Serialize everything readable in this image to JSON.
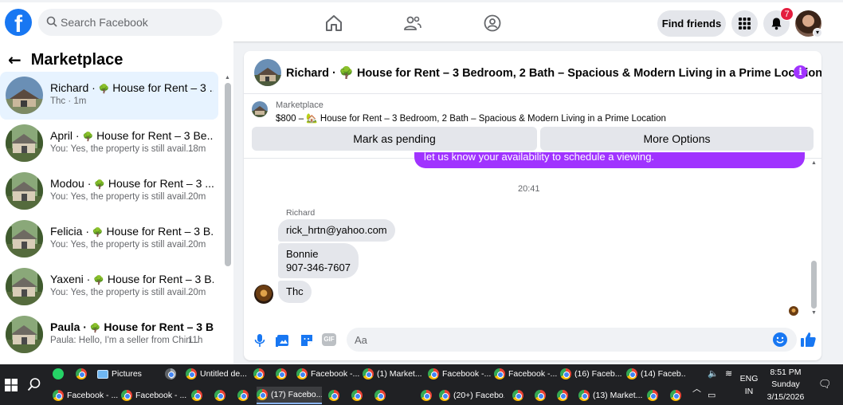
{
  "topbar": {
    "logo_letter": "f",
    "search_placeholder": "Search Facebook",
    "find_friends_label": "Find friends",
    "notification_count": "7"
  },
  "marketplace": {
    "title": "Marketplace",
    "conversations": [
      {
        "name": "Richard",
        "title": "House for Rent – 3 ...",
        "preview": "Thc · 1m",
        "time": "",
        "active": true,
        "bold": false
      },
      {
        "name": "April",
        "title": "House for Rent – 3 Be...",
        "preview": "You: Yes, the property is still avail...",
        "time": "18m",
        "active": false,
        "bold": false
      },
      {
        "name": "Modou",
        "title": "House for Rent – 3 ...",
        "preview": "You: Yes, the property is still avail...",
        "time": "20m",
        "active": false,
        "bold": false
      },
      {
        "name": "Felicia",
        "title": "House for Rent – 3 B...",
        "preview": "You: Yes, the property is still avail...",
        "time": "20m",
        "active": false,
        "bold": false
      },
      {
        "name": "Yaxeni",
        "title": "House for Rent – 3 B...",
        "preview": "You: Yes, the property is still avail...",
        "time": "20m",
        "active": false,
        "bold": false
      },
      {
        "name": "Paula",
        "title": "House for Rent – 3 Be...",
        "preview": "Paula: Hello, I'm a seller from Chin...",
        "time": "11h",
        "active": false,
        "bold": true
      }
    ]
  },
  "chat": {
    "header_title": "Richard · 🌳 House for Rent – 3 Bedroom, 2 Bath – Spacious & Modern Living in a Prime Location",
    "info_label": "i",
    "listing_label": "Marketplace",
    "listing_desc": "$800 – 🏡 House for Rent – 3 Bedroom, 2 Bath – Spacious & Modern Living in a Prime Location",
    "mark_pending_label": "Mark as pending",
    "more_options_label": "More Options",
    "outgoing_partial": "let us know your availability to schedule a viewing.",
    "timestamp": "20:41",
    "sender_name": "Richard",
    "messages": [
      "rick_hrtn@yahoo.com",
      "Bonnie",
      "907-346-7607",
      "Thc"
    ],
    "composer_placeholder": "Aa"
  },
  "taskbar": {
    "row1": [
      {
        "label": "",
        "icon": "whatsapp-icon"
      },
      {
        "label": "",
        "icon": "chrome-icon"
      },
      {
        "label": "Pictures",
        "icon": "pictures-icon"
      },
      {
        "label": "",
        "icon": "app-icon"
      },
      {
        "label": "Untitled de...",
        "icon": "chrome-icon"
      },
      {
        "label": "",
        "icon": "chrome-icon"
      },
      {
        "label": "",
        "icon": "chrome-icon"
      },
      {
        "label": "Facebook -...",
        "icon": "chrome-icon"
      },
      {
        "label": "(1) Market...",
        "icon": "chrome-icon"
      },
      {
        "label": "Facebook -...",
        "icon": "chrome-icon"
      },
      {
        "label": "Facebook -...",
        "icon": "chrome-icon"
      },
      {
        "label": "(16) Faceb...",
        "icon": "chrome-icon"
      },
      {
        "label": "(14) Faceb...",
        "icon": "chrome-icon"
      }
    ],
    "row2": [
      {
        "label": "Facebook - ...",
        "icon": "chrome-icon"
      },
      {
        "label": "Facebook - ...",
        "icon": "chrome-icon"
      },
      {
        "label": "",
        "icon": "chrome-icon"
      },
      {
        "label": "",
        "icon": "chrome-icon"
      },
      {
        "label": "",
        "icon": "chrome-icon"
      },
      {
        "label": "(17) Facebo...",
        "icon": "chrome-icon"
      },
      {
        "label": "",
        "icon": "chrome-icon"
      },
      {
        "label": "",
        "icon": "chrome-icon"
      },
      {
        "label": "",
        "icon": "chrome-icon"
      },
      {
        "label": "",
        "icon": "chrome-icon"
      },
      {
        "label": "(20+) Facebo...",
        "icon": "chrome-icon"
      },
      {
        "label": "",
        "icon": "chrome-icon"
      },
      {
        "label": "",
        "icon": "chrome-icon"
      },
      {
        "label": "",
        "icon": "chrome-icon"
      },
      {
        "label": "(13) Market...",
        "icon": "chrome-icon"
      },
      {
        "label": "",
        "icon": "chrome-icon"
      },
      {
        "label": "",
        "icon": "chrome-icon"
      }
    ],
    "lang_top": "ENG",
    "lang_bottom": "IN",
    "time": "8:51 PM",
    "day": "Sunday",
    "date": "3/15/2026"
  },
  "colors": {
    "brand": "#1877f2",
    "accent": "#a033ff",
    "active_row": "#e7f3ff",
    "badge": "#e41e3f"
  }
}
